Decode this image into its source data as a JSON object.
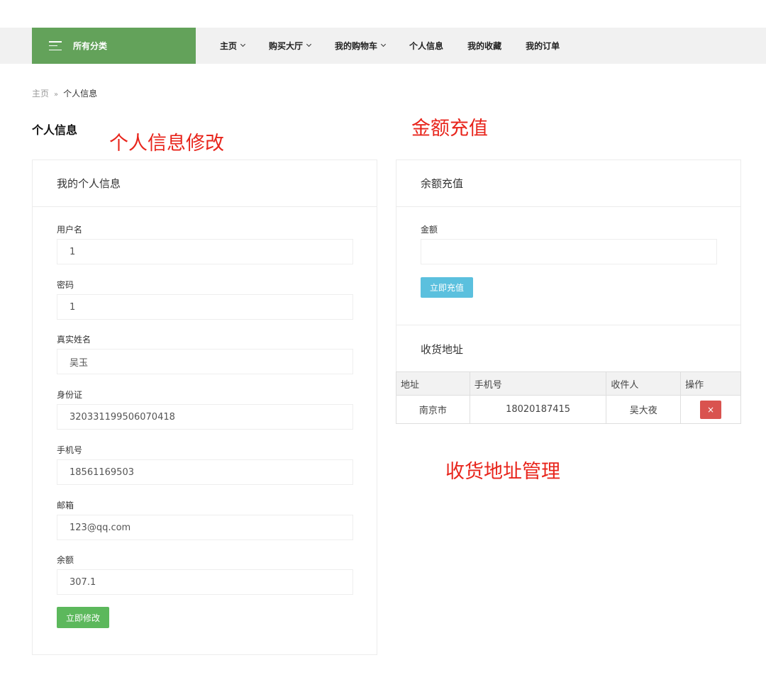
{
  "nav": {
    "all_categories": "所有分类",
    "items": [
      {
        "label": "主页",
        "dropdown": true
      },
      {
        "label": "购买大厅",
        "dropdown": true
      },
      {
        "label": "我的购物车",
        "dropdown": true
      },
      {
        "label": "个人信息",
        "dropdown": false
      },
      {
        "label": "我的收藏",
        "dropdown": false
      },
      {
        "label": "我的订单",
        "dropdown": false
      }
    ]
  },
  "breadcrumb": {
    "home": "主页",
    "sep": "»",
    "current": "个人信息"
  },
  "page_title": "个人信息",
  "annotations": {
    "profile": "个人信息修改",
    "recharge": "金额充值",
    "address": "收货地址管理"
  },
  "profile": {
    "title": "我的个人信息",
    "fields": [
      {
        "label": "用户名",
        "value": "1"
      },
      {
        "label": "密码",
        "value": "1"
      },
      {
        "label": "真实姓名",
        "value": "吴玉"
      },
      {
        "label": "身份证",
        "value": "320331199506070418"
      },
      {
        "label": "手机号",
        "value": "18561169503"
      },
      {
        "label": "邮箱",
        "value": "123@qq.com"
      },
      {
        "label": "余额",
        "value": "307.1"
      }
    ],
    "submit_label": "立即修改"
  },
  "recharge": {
    "title": "余额充值",
    "amount_label": "金额",
    "amount_value": "",
    "submit_label": "立即充值"
  },
  "address": {
    "title": "收货地址",
    "columns": [
      "地址",
      "手机号",
      "收件人",
      "操作"
    ],
    "rows": [
      {
        "address": "南京市",
        "phone": "18020187415",
        "receiver": "吴大夜",
        "delete_label": "×"
      }
    ]
  },
  "colors": {
    "nav_green": "#63a25a",
    "btn_green": "#5cb85c",
    "btn_blue": "#5bc0de",
    "btn_red": "#d9534f",
    "annotation_red": "#e8251c"
  }
}
